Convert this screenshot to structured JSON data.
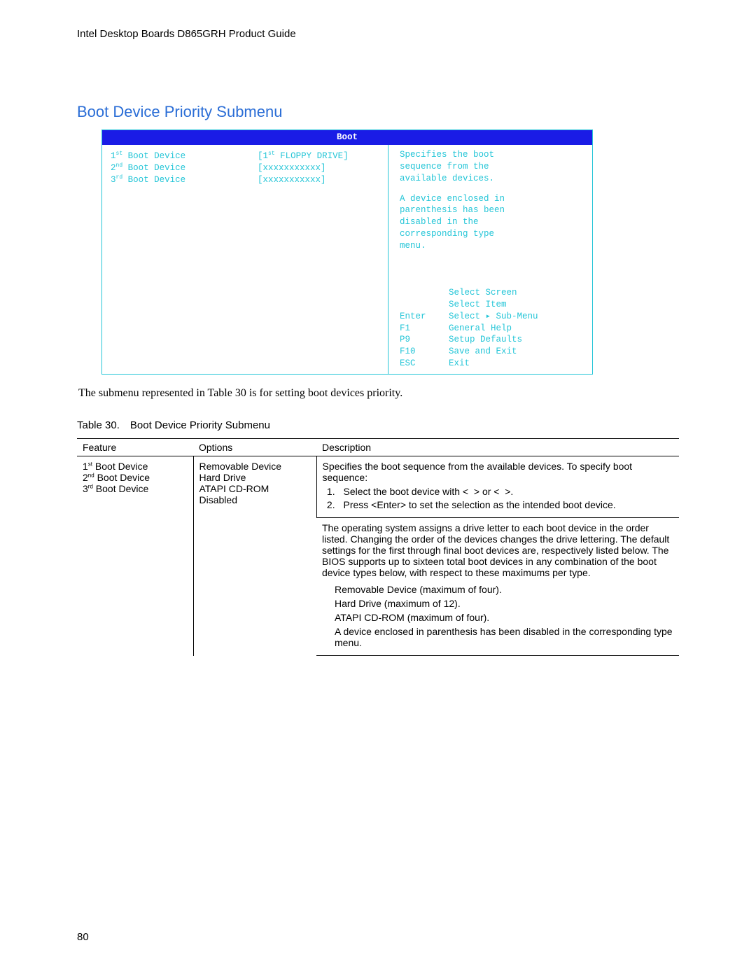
{
  "header": "Intel Desktop Boards D865GRH Product Guide",
  "section_title": "Boot Device Priority Submenu",
  "bios": {
    "title": "Boot",
    "rows": [
      {
        "label_pre": "1",
        "ord": "st",
        "label": "Boot Device",
        "val_pre": "[1",
        "val_ord": "st",
        "val_post": " FLOPPY DRIVE]"
      },
      {
        "label_pre": "2",
        "ord": "nd",
        "label": "Boot Device",
        "val": "[xxxxxxxxxxx]"
      },
      {
        "label_pre": "3",
        "ord": "rd",
        "label": "Boot Device",
        "val": "[xxxxxxxxxxx]"
      }
    ],
    "help_lines": [
      "Specifies the boot",
      "sequence from the",
      "available devices."
    ],
    "help_lines2": [
      "A device enclosed in",
      "parenthesis has been",
      "disabled in the",
      "corresponding type",
      "menu."
    ],
    "keys": [
      {
        "k": "",
        "a": "Select Screen"
      },
      {
        "k": "",
        "a": "Select Item"
      },
      {
        "k": "Enter",
        "a": "Select ▸ Sub-Menu"
      },
      {
        "k": "F1",
        "a": "General Help"
      },
      {
        "k": "P9",
        "a": "Setup Defaults"
      },
      {
        "k": "F10",
        "a": "Save and Exit"
      },
      {
        "k": "ESC",
        "a": "Exit"
      }
    ]
  },
  "caption": "The submenu represented in Table 30 is for setting boot devices priority.",
  "table_caption": "Table 30. Boot Device Priority Submenu",
  "table": {
    "headers": [
      "Feature",
      "Options",
      "Description"
    ],
    "feature_items": [
      {
        "pre": "1",
        "ord": "st",
        "txt": " Boot Device"
      },
      {
        "pre": "2",
        "ord": "nd",
        "txt": " Boot Device"
      },
      {
        "pre": "3",
        "ord": "rd",
        "txt": " Boot Device"
      }
    ],
    "option_items": [
      "Removable Device",
      "Hard Drive",
      "ATAPI CD-ROM",
      "Disabled"
    ],
    "desc1_intro": "Specifies the boot sequence from the available devices.  To specify boot sequence:",
    "desc1_li1": "Select the boot device with <  > or <  >.",
    "desc1_li2": "Press <Enter> to set the selection as the intended boot device.",
    "desc2_p": "The operating system assigns a drive letter to each boot device in the order listed.  Changing the order of the devices changes the drive lettering.  The default settings for the first through final boot devices are, respectively listed below.  The BIOS supports up to sixteen total boot devices in any combination of the boot device types below, with respect to these maximums per type.",
    "desc2_b1": "Removable Device (maximum of four).",
    "desc2_b2": "Hard Drive (maximum of 12).",
    "desc2_b3": "ATAPI CD-ROM (maximum of four).",
    "desc2_b4": "A device enclosed in parenthesis has been disabled in the corresponding type menu."
  },
  "page_number": "80"
}
